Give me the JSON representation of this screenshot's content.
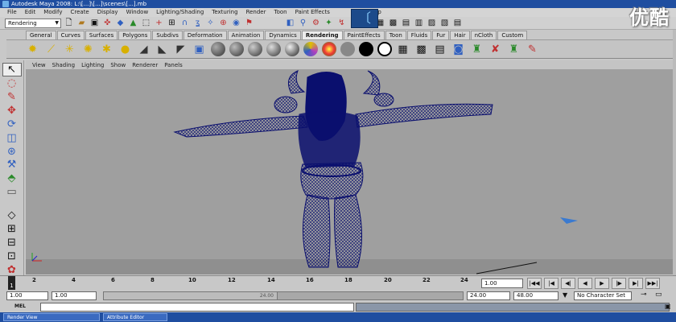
{
  "window": {
    "title": "Autodesk Maya 2008: L:\\[...]\\[...]\\scenes\\[...].mb"
  },
  "menubar": {
    "items": [
      "File",
      "Edit",
      "Modify",
      "Create",
      "Display",
      "Window",
      "Lighting/Shading",
      "Texturing",
      "Render",
      "Toon",
      "Paint Effects",
      "Help"
    ]
  },
  "status_line": {
    "mode": "Rendering"
  },
  "shelf": {
    "tabs": [
      "General",
      "Curves",
      "Surfaces",
      "Polygons",
      "Subdivs",
      "Deformation",
      "Animation",
      "Dynamics",
      "Rendering",
      "PaintEffects",
      "Toon",
      "Fluids",
      "Fur",
      "Hair",
      "nCloth",
      "Custom"
    ],
    "active_tab": "Rendering"
  },
  "panel_menu": {
    "items": [
      "View",
      "Shading",
      "Lighting",
      "Show",
      "Renderer",
      "Panels"
    ]
  },
  "timeline": {
    "ticks": [
      "2",
      "4",
      "6",
      "8",
      "10",
      "12",
      "14",
      "16",
      "18",
      "20",
      "22",
      "24"
    ],
    "current_frame_marker": "1",
    "current_time": "1.00"
  },
  "range": {
    "start_time": "1.00",
    "playback_start": "1.00",
    "range_handle_label": "24.00",
    "playback_end": "24.00",
    "end_time": "48.00",
    "character_set": "No Character Set"
  },
  "command_line": {
    "label": "MEL"
  },
  "taskbar": {
    "items": [
      "Render View",
      "Attribute Editor"
    ]
  },
  "watermark": "优酷",
  "colors": {
    "viewport_bg": "#9f9f9f",
    "wireframe": "#0a0f6e",
    "title_bar": "#1f4ea0"
  }
}
